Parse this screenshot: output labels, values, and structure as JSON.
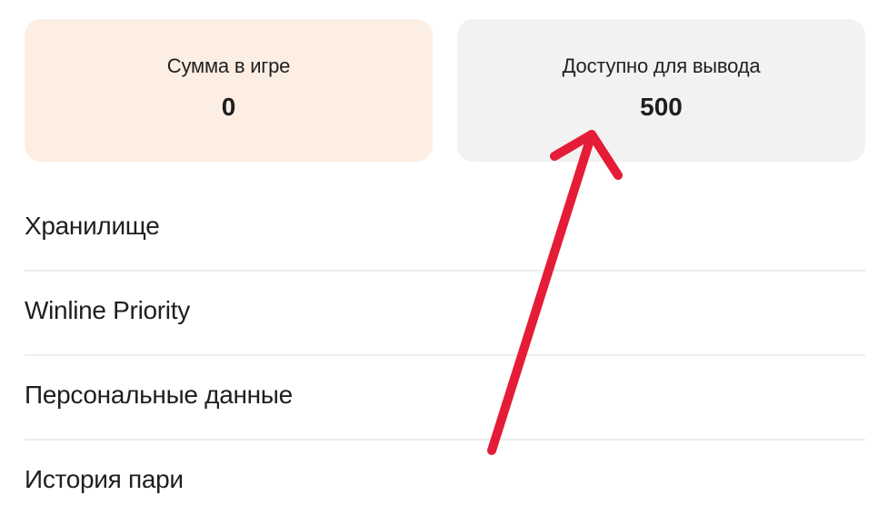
{
  "balance": {
    "in_game": {
      "label": "Сумма в игре",
      "value": "0"
    },
    "withdrawable": {
      "label": "Доступно для вывода",
      "value": "500"
    }
  },
  "menu": {
    "items": [
      {
        "label": "Хранилище"
      },
      {
        "label": "Winline Priority"
      },
      {
        "label": "Персональные данные"
      },
      {
        "label": "История пари"
      }
    ]
  },
  "colors": {
    "in_game_card_bg": "#fdeee3",
    "withdraw_card_bg": "#f2f2f2",
    "annotation_arrow": "#e51c37"
  }
}
